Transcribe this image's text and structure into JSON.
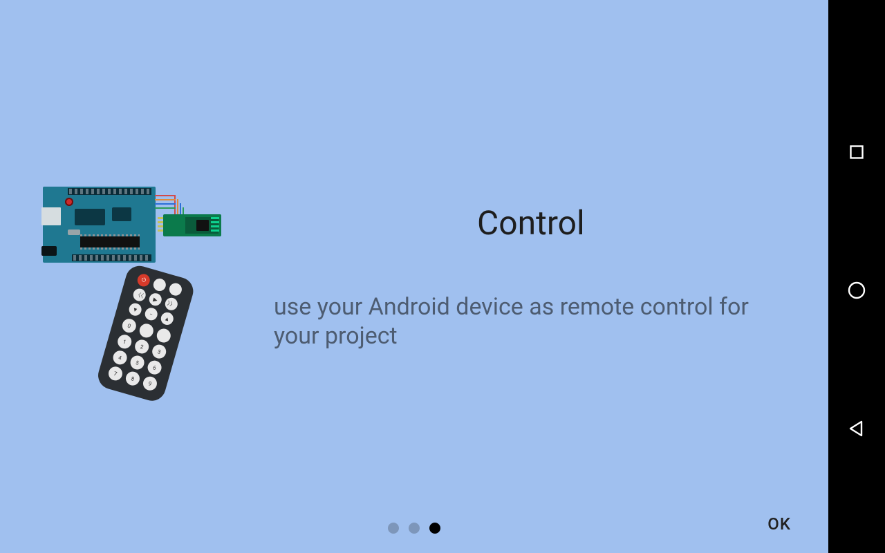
{
  "onboarding": {
    "title": "Control",
    "description": "use your Android device as remote control for your project",
    "page_count": 3,
    "active_page_index": 2
  },
  "footer": {
    "ok_label": "OK"
  },
  "navbar": {
    "recent_label": "Recent apps",
    "home_label": "Home",
    "back_label": "Back"
  },
  "illustration": {
    "arduino_name": "Arduino Uno board",
    "bt_module_name": "Bluetooth module",
    "remote_name": "IR remote control"
  }
}
